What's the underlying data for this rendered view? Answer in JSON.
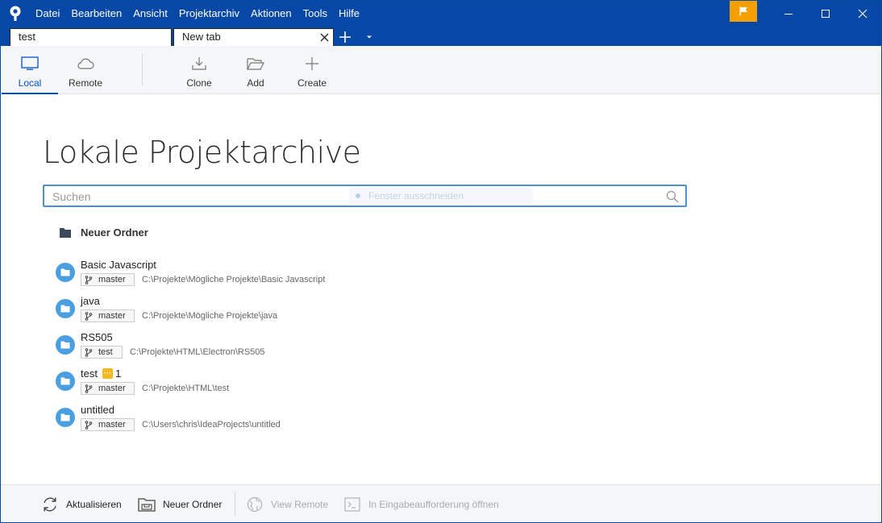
{
  "menu": [
    "Datei",
    "Bearbeiten",
    "Ansicht",
    "Projektarchiv",
    "Aktionen",
    "Tools",
    "Hilfe"
  ],
  "window_controls": {
    "minimize": "minimize-icon",
    "maximize": "maximize-icon",
    "close": "close-icon"
  },
  "tabs": [
    {
      "label": "test",
      "active": false
    },
    {
      "label": "New tab",
      "active": true
    }
  ],
  "toolbar": {
    "local": "Local",
    "remote": "Remote",
    "clone": "Clone",
    "add": "Add",
    "create": "Create"
  },
  "main": {
    "title": "Lokale Projektarchive",
    "search_placeholder": "Suchen",
    "search_overlay": "Fenster ausschneiden",
    "group_label": "Neuer Ordner"
  },
  "repos": [
    {
      "name": "Basic Javascript",
      "branch": "master",
      "path": "C:\\Projekte\\Mögliche Projekte\\Basic Javascript",
      "badge": null
    },
    {
      "name": "java",
      "branch": "master",
      "path": "C:\\Projekte\\Mögliche Projekte\\java",
      "badge": null
    },
    {
      "name": "RS505",
      "branch": "test",
      "path": "C:\\Projekte\\HTML\\Electron\\RS505",
      "badge": null
    },
    {
      "name": "test",
      "branch": "master",
      "path": "C:\\Projekte\\HTML\\test",
      "badge": "1"
    },
    {
      "name": "untitled",
      "branch": "master",
      "path": "C:\\Users\\chris\\IdeaProjects\\untitled",
      "badge": null
    }
  ],
  "footer": {
    "refresh": "Aktualisieren",
    "new_folder": "Neuer Ordner",
    "view_remote": "View Remote",
    "open_terminal": "In Eingabeaufforderung öffnen"
  },
  "colors": {
    "titlebar": "#0747a6",
    "accent": "#0052cc",
    "repo_icon": "#4a9fe0",
    "flag": "#f5a000",
    "badge": "#f5b820"
  }
}
